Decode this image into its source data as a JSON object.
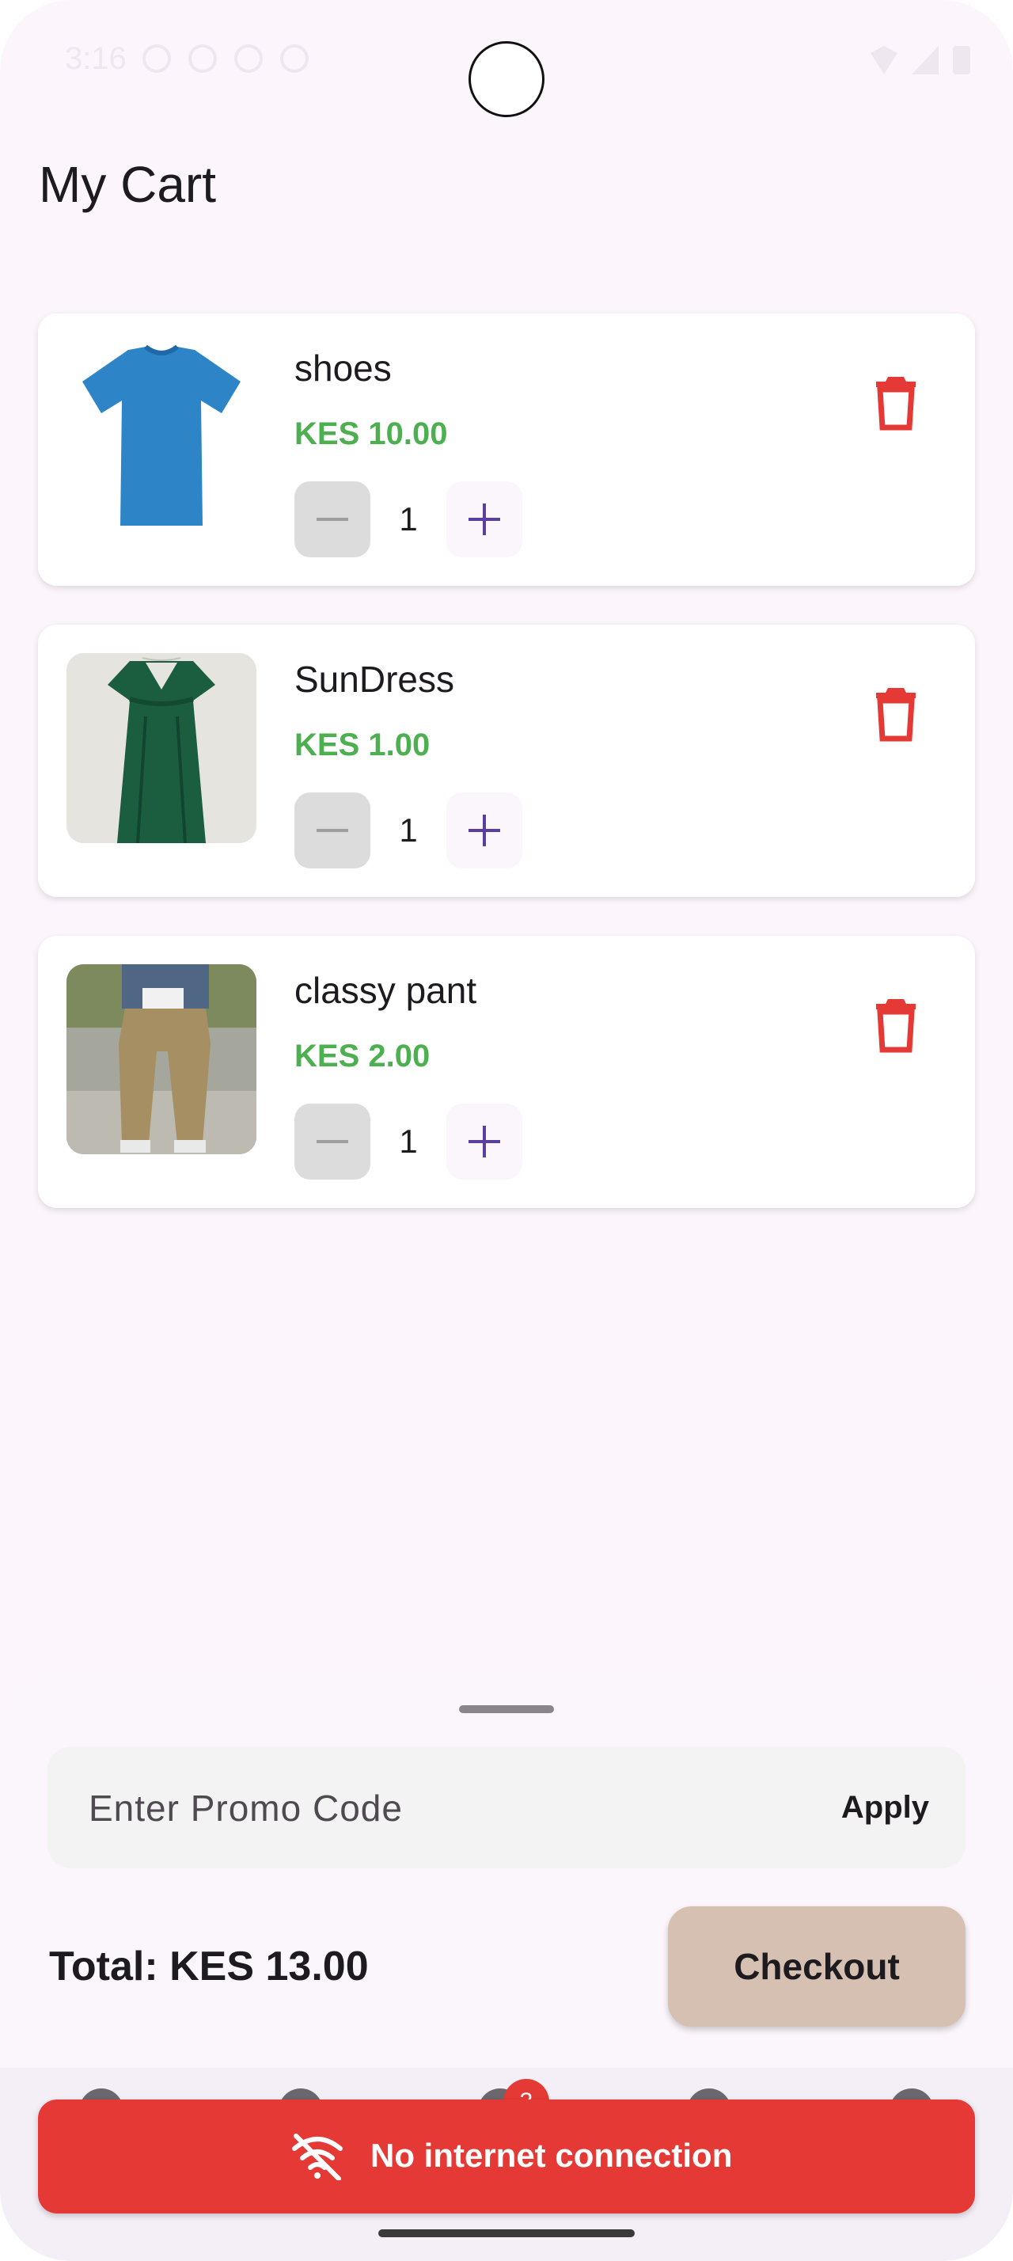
{
  "status_bar": {
    "time": "3:16"
  },
  "header": {
    "title": "My Cart"
  },
  "cart": {
    "items": [
      {
        "name": "shoes",
        "price": "KES 10.00",
        "quantity": "1",
        "image_icon": "blue-tshirt"
      },
      {
        "name": "SunDress",
        "price": "KES 1.00",
        "quantity": "1",
        "image_icon": "green-dress"
      },
      {
        "name": "classy pant",
        "price": "KES 2.00",
        "quantity": "1",
        "image_icon": "khaki-pants"
      }
    ]
  },
  "summary": {
    "promo_placeholder": "Enter Promo Code",
    "apply_label": "Apply",
    "total": "Total: KES 13.00",
    "checkout_label": "Checkout"
  },
  "nav": {
    "cart_badge": "3"
  },
  "snackbar": {
    "message": "No internet connection",
    "icon": "wifi-off-icon"
  },
  "colors": {
    "background": "#fcf5fc",
    "price": "#4caf50",
    "delete": "#e53935",
    "checkout": "#d6c0b2",
    "snackbar": "#e53935",
    "accent": "#5b3f9e"
  }
}
